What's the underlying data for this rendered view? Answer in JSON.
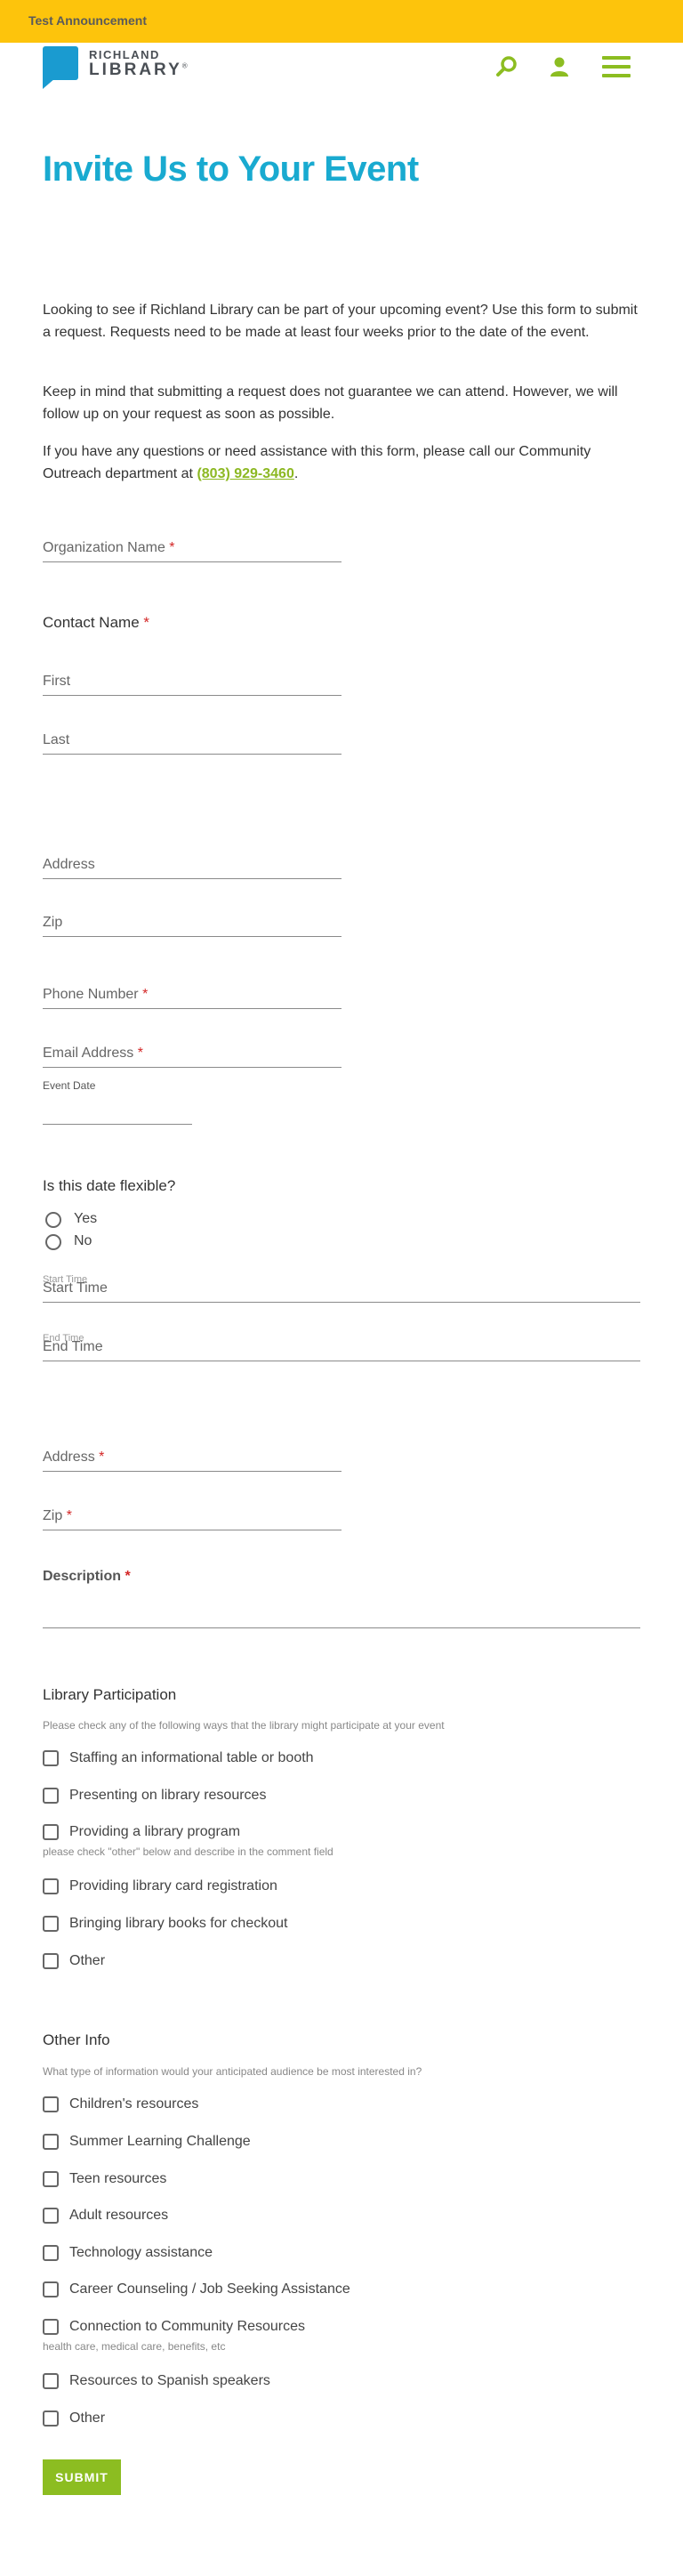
{
  "announcement": "Test Announcement",
  "logo": {
    "line1": "RICHLAND",
    "line2": "LIBRARY",
    "mark": "®"
  },
  "header_icons": [
    "search-icon",
    "user-icon",
    "menu-icon"
  ],
  "title": "Invite Us to Your Event",
  "intro": {
    "p1": "Looking to see if Richland Library can be part of your upcoming event? Use this form to submit a request. Requests need to be made at least four weeks prior to the date of the event.",
    "p2": "Keep in mind that submitting a request does not guarantee we can attend. However, we will follow up on your request as soon as possible.",
    "p3_before": "If you have any questions or need assistance with this form, please call our Community Outreach department at ",
    "p3_phone": "(803) 929-3460",
    "p3_after": "."
  },
  "form": {
    "organization": "Organization Name",
    "contact_name": "Contact Name",
    "first": "First",
    "last": "Last",
    "address": "Address",
    "zip": "Zip",
    "phone": "Phone Number",
    "email": "Email Address",
    "event_date": "Event Date",
    "flexible": "Is this date flexible?",
    "yes": "Yes",
    "no": "No",
    "start_time": "Start Time",
    "end_time": "End Time",
    "event_address": "Address",
    "event_zip": "Zip",
    "description": "Description",
    "required_mark": "*"
  },
  "participation": {
    "title": "Library Participation",
    "help": "Please check any of the following ways that the library might participate at your event",
    "options": [
      "Staffing an informational table or booth",
      "Presenting on library resources",
      "Providing a library program",
      "Providing library card registration",
      "Bringing library books for checkout",
      "Other"
    ],
    "program_note": "please check \"other\" below and describe in the comment field"
  },
  "other_info": {
    "title": "Other Info",
    "help": "What type of information would your anticipated audience be most interested in?",
    "options": [
      "Children's resources",
      "Summer Learning Challenge",
      "Teen resources",
      "Adult resources",
      "Technology assistance",
      "Career Counseling / Job Seeking Assistance",
      "Connection to Community Resources",
      "Resources to Spanish speakers",
      "Other"
    ],
    "community_note": "health care, medical care, benefits, etc"
  },
  "submit": "SUBMIT",
  "colors": {
    "accent": "#19aad0",
    "green": "#8cbd21",
    "banner": "#fdc40c"
  }
}
